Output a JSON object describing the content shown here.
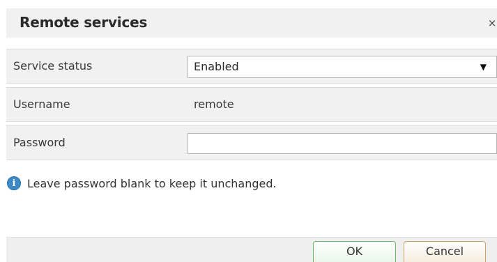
{
  "dialog": {
    "title": "Remote services",
    "close_glyph": "×"
  },
  "fields": {
    "service_status": {
      "label": "Service status",
      "selected": "Enabled",
      "arrow": "▼"
    },
    "username": {
      "label": "Username",
      "value": "remote"
    },
    "password": {
      "label": "Password",
      "value": "",
      "placeholder": ""
    }
  },
  "info": {
    "icon": "info-icon",
    "icon_glyph": "i",
    "text": "Leave password blank to keep it unchanged."
  },
  "buttons": {
    "ok": "OK",
    "cancel": "Cancel"
  },
  "colors": {
    "ok_border": "#6ab96a",
    "cancel_border": "#c9a46a",
    "info_icon": "#3d89c6"
  }
}
